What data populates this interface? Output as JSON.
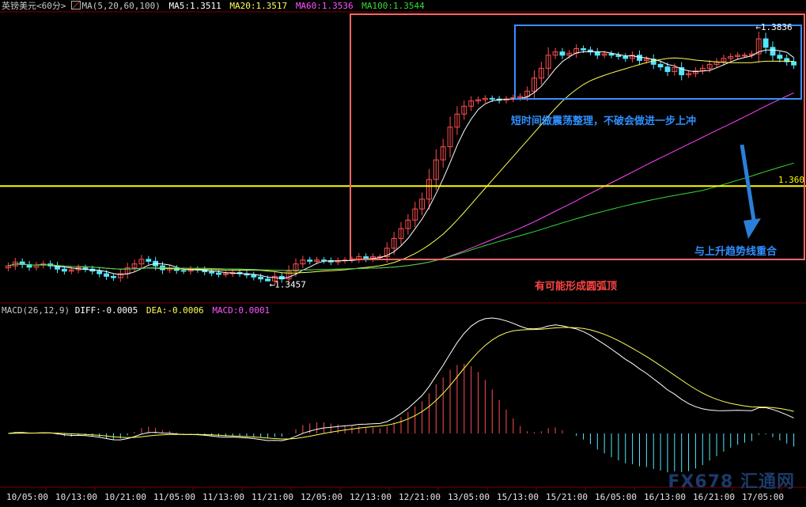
{
  "colors": {
    "up": "#ff4d4d",
    "down": "#55e6ff",
    "ma5": "#ffffff",
    "ma20": "#ffff55",
    "ma60": "#ff44ff",
    "ma100": "#33dd33",
    "level": "#ffff00",
    "red_box": "#ff6666",
    "blue_box": "#3b8fff",
    "annot_blue": "#2f8fff",
    "annot_red": "#ff4444",
    "dea": "#ffff55",
    "diff": "#ffffff"
  },
  "header": {
    "symbol": "英镑美元<60分>",
    "ma_params": "MA(5,20,60,100)",
    "ma5": "MA5:1.3511",
    "ma20": "MA20:1.3517",
    "ma60": "MA60:1.3536",
    "ma100": "MA100:1.3544"
  },
  "macd_header": {
    "params": "MACD(26,12,9)",
    "diff": "DIFF:-0.0005",
    "dea": "DEA:-0.0006",
    "macd": "MACD:0.0001"
  },
  "annotations": {
    "high_label": "1.3836",
    "low_label": "1.3457",
    "level_label": "1.360",
    "consolidation": "短时间做震荡整理，不破会做进一步上冲",
    "trendline": "与上升趋势线重合",
    "top_pattern": "有可能形成圆弧顶"
  },
  "watermark": "FX678 汇通网",
  "chart_data": [
    {
      "type": "candlestick",
      "title": "英镑美元<60分>",
      "x_ticks": [
        "10/05:00",
        "10/13:00",
        "10/21:00",
        "11/05:00",
        "11/13:00",
        "11/21:00",
        "12/05:00",
        "12/13:00",
        "12/21:00",
        "13/05:00",
        "15/13:00",
        "15/21:00",
        "16/05:00",
        "16/13:00",
        "16/21:00",
        "17/05:00"
      ],
      "ylim": [
        1.3425,
        1.3865
      ],
      "hline": 1.36,
      "high": 1.3836,
      "low": 1.3457,
      "closes": [
        1.3478,
        1.3484,
        1.348,
        1.3476,
        1.3479,
        1.3481,
        1.3478,
        1.3473,
        1.347,
        1.3472,
        1.3475,
        1.3473,
        1.347,
        1.3466,
        1.3462,
        1.346,
        1.3466,
        1.3475,
        1.3481,
        1.3488,
        1.3485,
        1.3478,
        1.3472,
        1.3474,
        1.3471,
        1.347,
        1.3473,
        1.3472,
        1.3469,
        1.3467,
        1.3465,
        1.3466,
        1.3468,
        1.3466,
        1.3464,
        1.3461,
        1.3458,
        1.3455,
        1.3462,
        1.3458,
        1.347,
        1.3481,
        1.3487,
        1.3485,
        1.3487,
        1.3486,
        1.3484,
        1.3486,
        1.3487,
        1.3488,
        1.3492,
        1.3489,
        1.3492,
        1.3492,
        1.3505,
        1.352,
        1.3535,
        1.3548,
        1.3565,
        1.358,
        1.361,
        1.364,
        1.366,
        1.369,
        1.371,
        1.3722,
        1.373,
        1.3732,
        1.3734,
        1.3733,
        1.3731,
        1.3733,
        1.3735,
        1.3737,
        1.3745,
        1.3765,
        1.378,
        1.38,
        1.3805,
        1.38,
        1.3803,
        1.381,
        1.3808,
        1.3805,
        1.38,
        1.3802,
        1.38,
        1.3798,
        1.3795,
        1.38,
        1.3792,
        1.3794,
        1.3786,
        1.3782,
        1.3775,
        1.3781,
        1.377,
        1.3772,
        1.3776,
        1.378,
        1.3786,
        1.379,
        1.3795,
        1.3798,
        1.38,
        1.38,
        1.3802,
        1.3825,
        1.3812,
        1.38,
        1.3795,
        1.379,
        1.3785
      ]
    },
    {
      "type": "bar",
      "title": "MACD(26,12,9)",
      "diff": -0.0005,
      "dea": -0.0006,
      "macd": 0.0001
    }
  ]
}
